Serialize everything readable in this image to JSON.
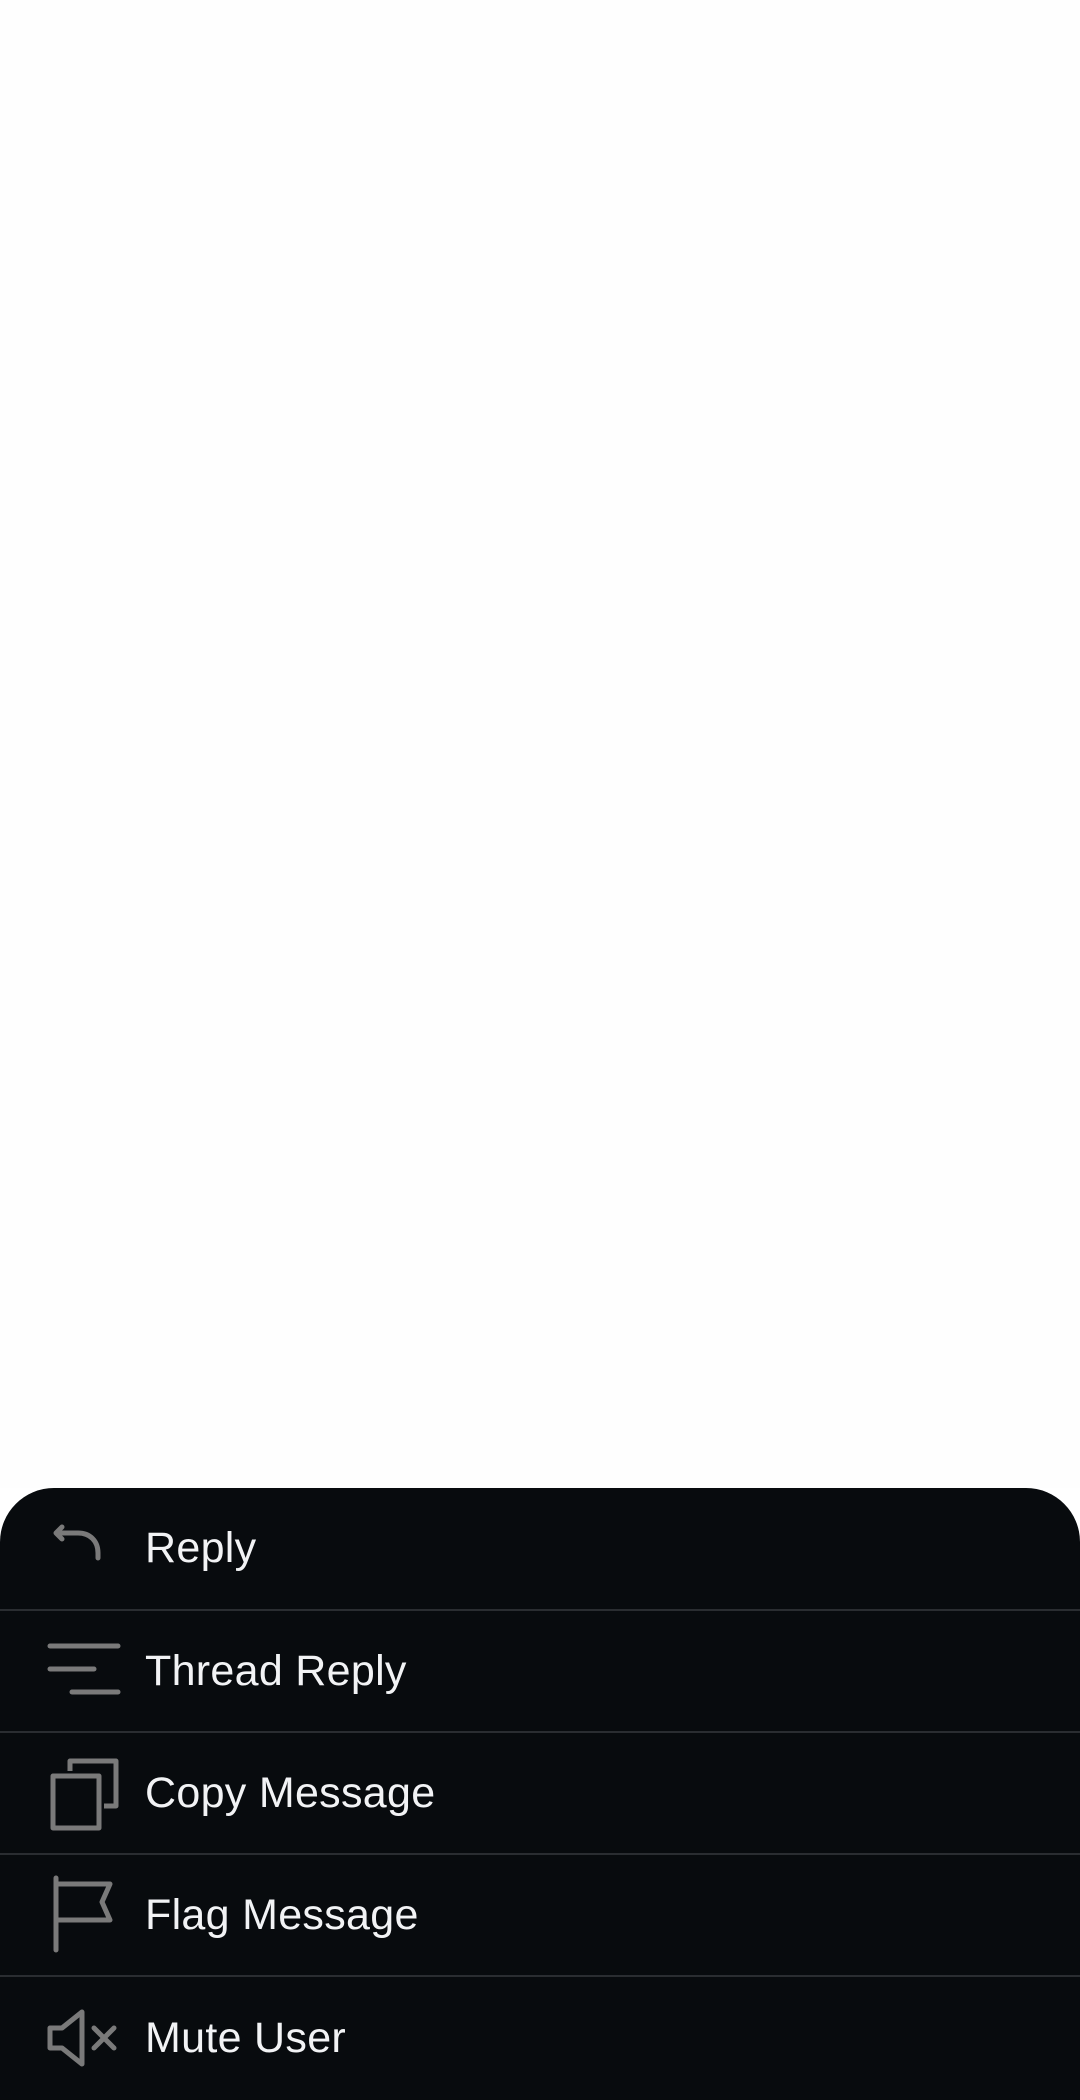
{
  "menu": {
    "items": [
      {
        "label": "Reply",
        "icon": "reply-icon"
      },
      {
        "label": "Thread Reply",
        "icon": "thread-reply-icon"
      },
      {
        "label": "Copy Message",
        "icon": "copy-icon"
      },
      {
        "label": "Flag Message",
        "icon": "flag-icon"
      },
      {
        "label": "Mute User",
        "icon": "mute-icon"
      }
    ]
  },
  "colors": {
    "sheet_background": "#080b0e",
    "divider": "#2a2d31",
    "icon": "#7a7a7a",
    "label_text": "#f2f3f5",
    "page_background": "#ffffff"
  }
}
